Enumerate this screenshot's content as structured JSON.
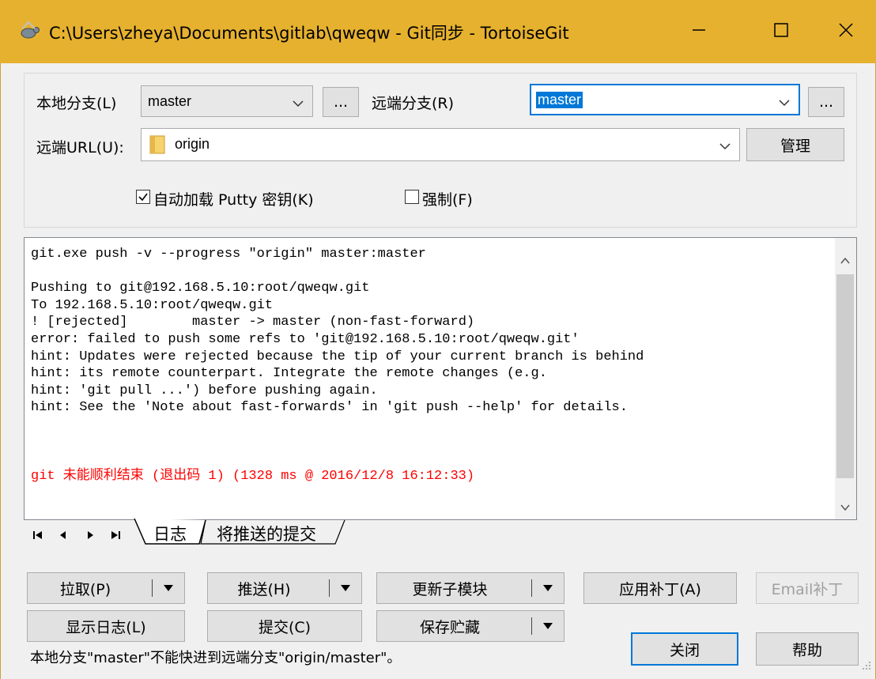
{
  "window": {
    "title": "C:\\Users\\zheya\\Documents\\gitlab\\qweqw - Git同步 - TortoiseGit",
    "app_icon": "tortoise-icon",
    "colors": {
      "titlebar": "#e6b12f",
      "accent": "#0078d7",
      "error": "#ff0000"
    }
  },
  "form": {
    "local_branch_label": "本地分支(L)",
    "local_branch_value": "master",
    "remote_branch_label": "远端分支(R)",
    "remote_branch_value": "master",
    "remote_url_label": "远端URL(U):",
    "remote_url_value": "origin",
    "manage_label": "管理",
    "browse_label": "...",
    "autoload_putty_label": "自动加载 Putty 密钥(K)",
    "autoload_putty_checked": true,
    "force_label": "强制(F)",
    "force_checked": false
  },
  "log": {
    "lines": [
      "git.exe push -v --progress \"origin\" master:master",
      "",
      "Pushing to git@192.168.5.10:root/qweqw.git",
      "To 192.168.5.10:root/qweqw.git",
      "! [rejected]        master -> master (non-fast-forward)",
      "error: failed to push some refs to 'git@192.168.5.10:root/qweqw.git'",
      "hint: Updates were rejected because the tip of your current branch is behind",
      "hint: its remote counterpart. Integrate the remote changes (e.g.",
      "hint: 'git pull ...') before pushing again.",
      "hint: See the 'Note about fast-forwards' in 'git push --help' for details.",
      "",
      "",
      ""
    ],
    "error_line": "git 未能顺利结束 (退出码 1) (1328 ms @ 2016/12/8 16:12:33)"
  },
  "tabs": [
    {
      "label": "日志",
      "active": true
    },
    {
      "label": "将推送的提交",
      "active": false
    }
  ],
  "buttons": {
    "pull": "拉取(P)",
    "push": "推送(H)",
    "update_submodules": "更新子模块",
    "apply_patch": "应用补丁(A)",
    "email_patch": "Email补丁",
    "show_log": "显示日志(L)",
    "commit": "提交(C)",
    "stash": "保存贮藏",
    "close": "关闭",
    "help": "帮助"
  },
  "status": "本地分支\"master\"不能快进到远端分支\"origin/master\"。"
}
